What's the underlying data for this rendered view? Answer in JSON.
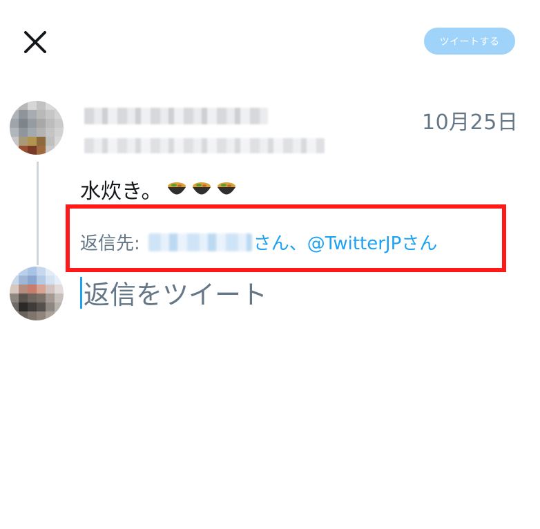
{
  "header": {
    "close_icon": "close-icon",
    "tweet_button_label": "ツイートする",
    "tweet_button_color": "#9fd3f9"
  },
  "original_tweet": {
    "date": "10月25日",
    "text": "水炊き。",
    "emoji": [
      "hot-pot-icon",
      "hot-pot-icon",
      "hot-pot-icon"
    ]
  },
  "reply_info": {
    "prefix": "返信先:",
    "suffix_label": "さん、@TwitterJPさん",
    "highlight_color": "#ff1a1a",
    "link_color": "#1da1f2"
  },
  "compose": {
    "placeholder": "返信をツイート"
  }
}
